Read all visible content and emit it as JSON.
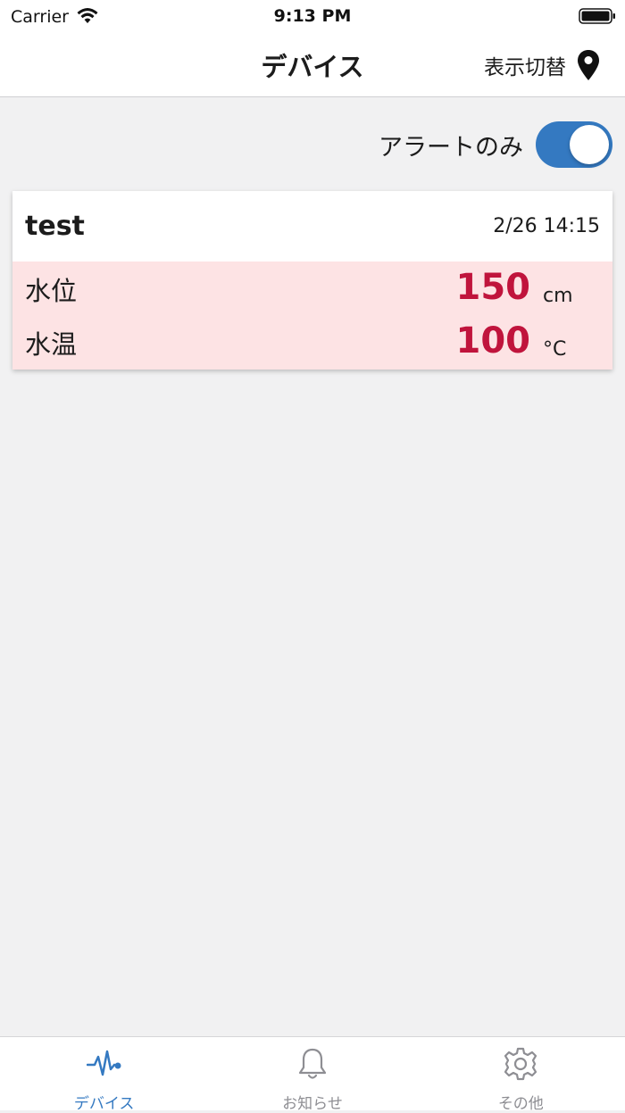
{
  "statusbar": {
    "carrier": "Carrier",
    "time": "9:13 PM"
  },
  "navbar": {
    "title": "デバイス",
    "toggle_view_label": "表示切替"
  },
  "filter": {
    "alert_only_label": "アラートのみ",
    "alert_only_on": true
  },
  "device": {
    "name": "test",
    "timestamp": "2/26 14:15",
    "metrics": [
      {
        "label": "水位",
        "value": "150",
        "unit": "cm"
      },
      {
        "label": "水温",
        "value": "100",
        "unit": "°C"
      }
    ]
  },
  "tabs": [
    {
      "label": "デバイス",
      "icon": "pulse-icon",
      "active": true
    },
    {
      "label": "お知らせ",
      "icon": "bell-icon",
      "active": false
    },
    {
      "label": "その他",
      "icon": "gear-icon",
      "active": false
    }
  ],
  "colors": {
    "accent": "#3479c1",
    "alert_value": "#c0143c",
    "alert_background": "#fde3e4",
    "inactive_tab": "#8e8e93"
  }
}
